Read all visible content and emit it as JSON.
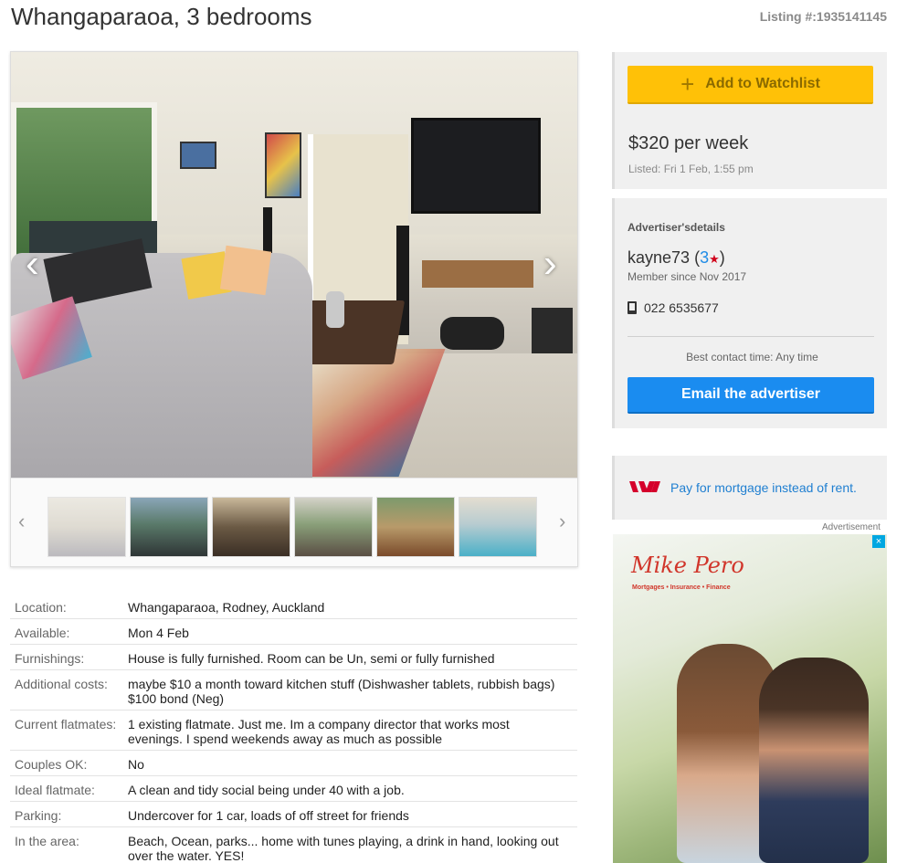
{
  "header": {
    "title": "Whangaparaoa, 3 bedrooms",
    "listing_number": "Listing #:1935141145"
  },
  "gallery": {
    "prev_arrow": "‹",
    "next_arrow": "›",
    "thumb_prev": "‹",
    "thumb_next": "›",
    "thumbnail_count": 6
  },
  "details": [
    {
      "label": "Location:",
      "value": "Whangaparaoa, Rodney, Auckland"
    },
    {
      "label": "Available:",
      "value": "Mon 4 Feb"
    },
    {
      "label": "Furnishings:",
      "value": "House is fully furnished. Room can be Un, semi or fully furnished"
    },
    {
      "label": "Additional costs:",
      "value": "maybe $10 a month toward kitchen stuff (Dishwasher tablets, rubbish bags)\n$100 bond (Neg)"
    },
    {
      "label": "Current flatmates:",
      "value": "1 existing flatmate. Just me. Im a company director that works most\nevenings. I spend weekends away as much as possible"
    },
    {
      "label": "Couples OK:",
      "value": "No"
    },
    {
      "label": "Ideal flatmate:",
      "value": "A clean and tidy social being under 40 with a job."
    },
    {
      "label": "Parking:",
      "value": "Undercover for 1 car, loads of off street for friends"
    },
    {
      "label": "In the area:",
      "value": "Beach, Ocean, parks... home with tunes playing, a drink in hand, looking out\nover the water. YES!"
    }
  ],
  "sidebar": {
    "watchlist_label": "Add to Watchlist",
    "price": "$320 per week",
    "listed": "Listed: Fri 1 Feb, 1:55 pm",
    "advertiser_heading": "Advertiser'sdetails",
    "advertiser_name": "kayne73",
    "rating_open": " (",
    "rating": "3",
    "rating_close": ")",
    "member_since": "Member since Nov 2017",
    "phone": "022 6535677",
    "best_contact": "Best contact time: Any time",
    "email_label": "Email the advertiser",
    "mortgage_link": "Pay for mortgage instead of rent."
  },
  "ad": {
    "label": "Advertisement",
    "close": "×",
    "brand": "Mike Pero",
    "tagline": "Mortgages • Insurance • Finance"
  },
  "colors": {
    "watchlist": "#ffc107",
    "email": "#1a8cf0",
    "link": "#1f7fd1",
    "westpac": "#d5002b"
  }
}
